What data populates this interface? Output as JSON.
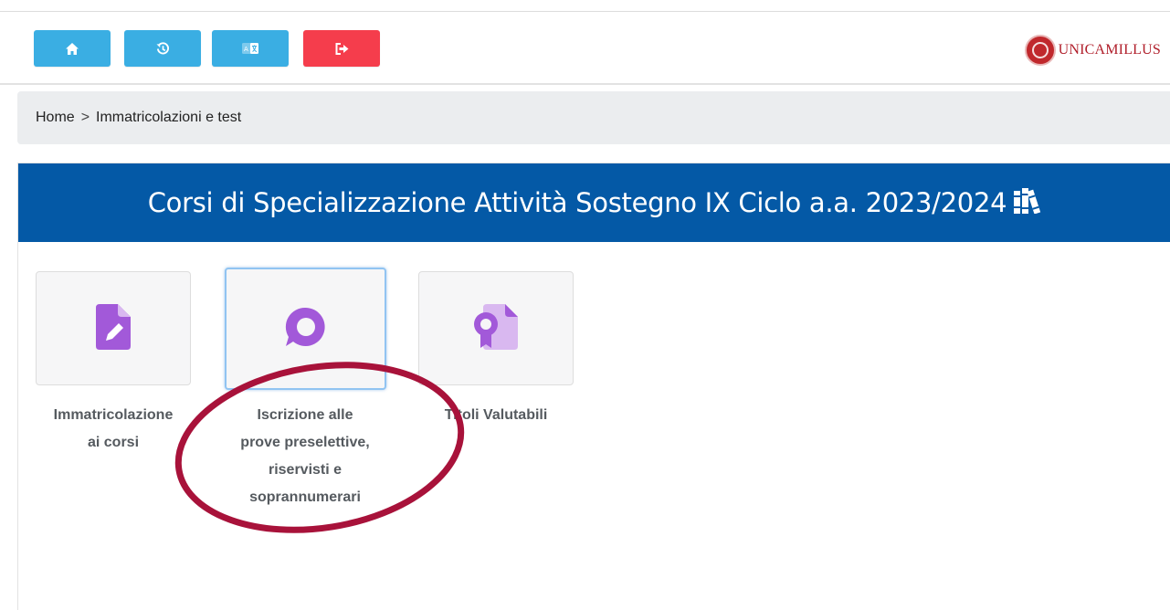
{
  "toolbar": {
    "buttons": [
      {
        "icon": "home-icon",
        "color": "#3aaee3"
      },
      {
        "icon": "history-icon",
        "color": "#3aaee3"
      },
      {
        "icon": "language-icon",
        "color": "#3aaee3"
      },
      {
        "icon": "logout-icon",
        "color": "#f53d4c"
      }
    ],
    "logo_text": "UNICAMILLUS",
    "logo_color": "#b01e2a"
  },
  "breadcrumb": {
    "home": "Home",
    "separator": ">",
    "current": "Immatricolazioni e test"
  },
  "panel": {
    "title": "Corsi di Specializzazione Attività Sostegno IX Ciclo a.a. 2023/2024",
    "title_icon": "books-icon",
    "header_color": "#0459a6"
  },
  "tiles": [
    {
      "icon": "file-edit-icon",
      "label_lines": [
        "Immatricolazione",
        "ai corsi"
      ],
      "selected": false
    },
    {
      "icon": "chat-bubble-icon",
      "label_lines": [
        "Iscrizione alle",
        "prove preselettive,",
        "riservisti e",
        "soprannumerari"
      ],
      "selected": true
    },
    {
      "icon": "file-certificate-icon",
      "label_lines": [
        "Titoli Valutabili"
      ],
      "selected": false
    }
  ],
  "colors": {
    "icon_purple": "#a259d9",
    "icon_purple_light": "#d9b8f0",
    "annotation_ring": "#a8123a"
  }
}
